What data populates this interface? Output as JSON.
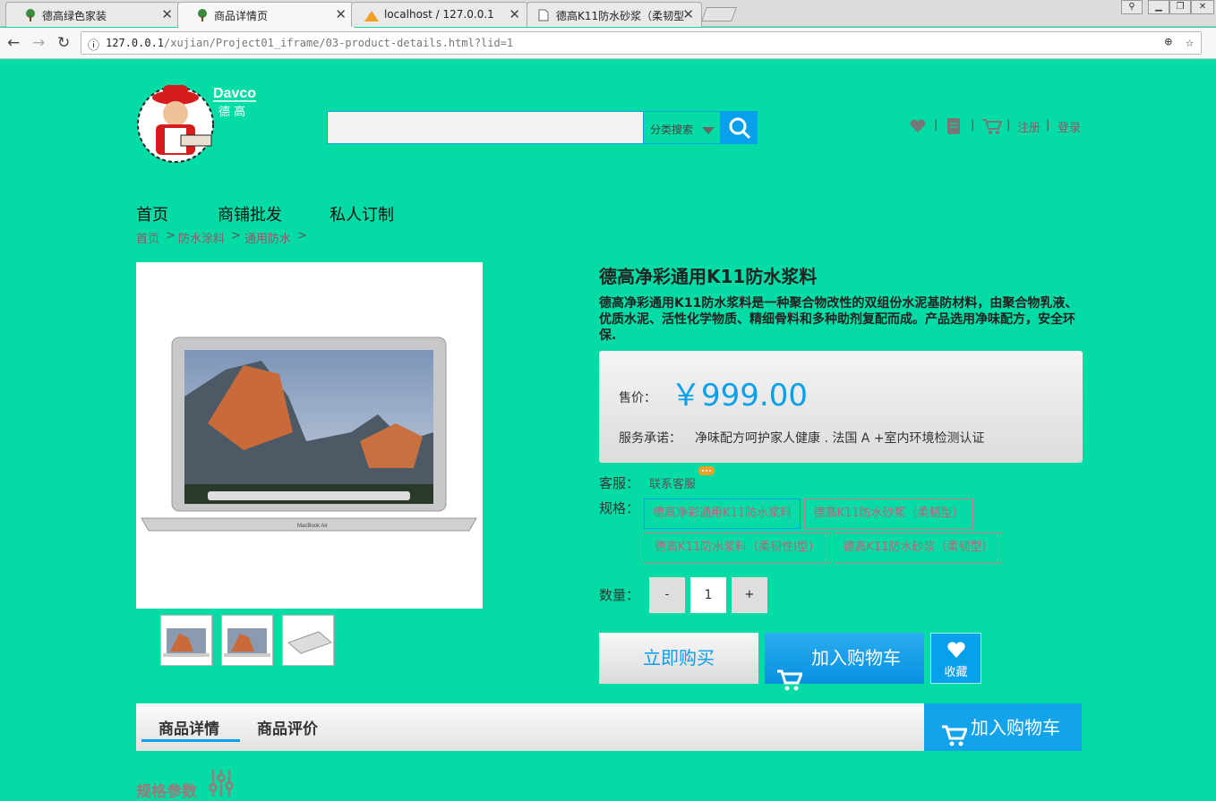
{
  "browser": {
    "tabs": [
      {
        "label": "德高绿色家装"
      },
      {
        "label": "商品详情页"
      },
      {
        "label": "localhost / 127.0.0.1"
      },
      {
        "label": "德高K11防水砂浆（柔韧型"
      }
    ],
    "url_host": "127.0.0.1",
    "url_path": "/xujian/Project01_iframe/03-product-details.html?lid=1"
  },
  "header": {
    "logo_text": "Davco",
    "logo_sub": "德 高",
    "search_placeholder": "",
    "search_category": "分类搜索",
    "links": {
      "register": "注册",
      "login": "登录",
      "sep": "|"
    }
  },
  "nav": {
    "items": [
      "首页",
      "商铺批发",
      "私人订制"
    ]
  },
  "breadcrumb": {
    "items": [
      "首页",
      "防水涂料",
      "通用防水"
    ],
    "sep": ">"
  },
  "product": {
    "title": "德高净彩通用K11防水浆料",
    "description": "德高净彩通用K11防水浆料是一种聚合物改性的双组份水泥基防材料，由聚合物乳液、优质水泥、活性化学物质、精细骨料和多种助剂复配而成。产品选用净味配方，安全环保.",
    "price_label": "售价：",
    "price": "￥999.00",
    "service_label": "服务承诺：",
    "service": "净味配方呵护家人健康 . 法国 A +室内环境检测认证",
    "cs_label": "客服：",
    "cs_link": "联系客服",
    "spec_label": "规格：",
    "specs": [
      {
        "label": "德高净彩通用K11防水浆料",
        "selected": true
      },
      {
        "label": "德高K11防水砂浆（柔韧型）",
        "selected": false
      },
      {
        "label": "德高K11防水浆料（柔韧性I型）",
        "selected": false
      },
      {
        "label": "德高K11防水砂浆（柔韧型）",
        "selected": false
      }
    ],
    "qty_label": "数量：",
    "qty_minus": "-",
    "qty_value": "1",
    "qty_plus": "+",
    "buy_now": "立即购买",
    "add_cart": "加入购物车",
    "favorite": "收藏",
    "laptop_brand": "MacBook Air"
  },
  "tabs": {
    "details": "商品详情",
    "reviews": "商品评价",
    "add_cart": "加入购物车"
  },
  "spec_params": "规格参数",
  "colors": {
    "page_bg": "#05dca5",
    "accent": "#08a0ea"
  }
}
